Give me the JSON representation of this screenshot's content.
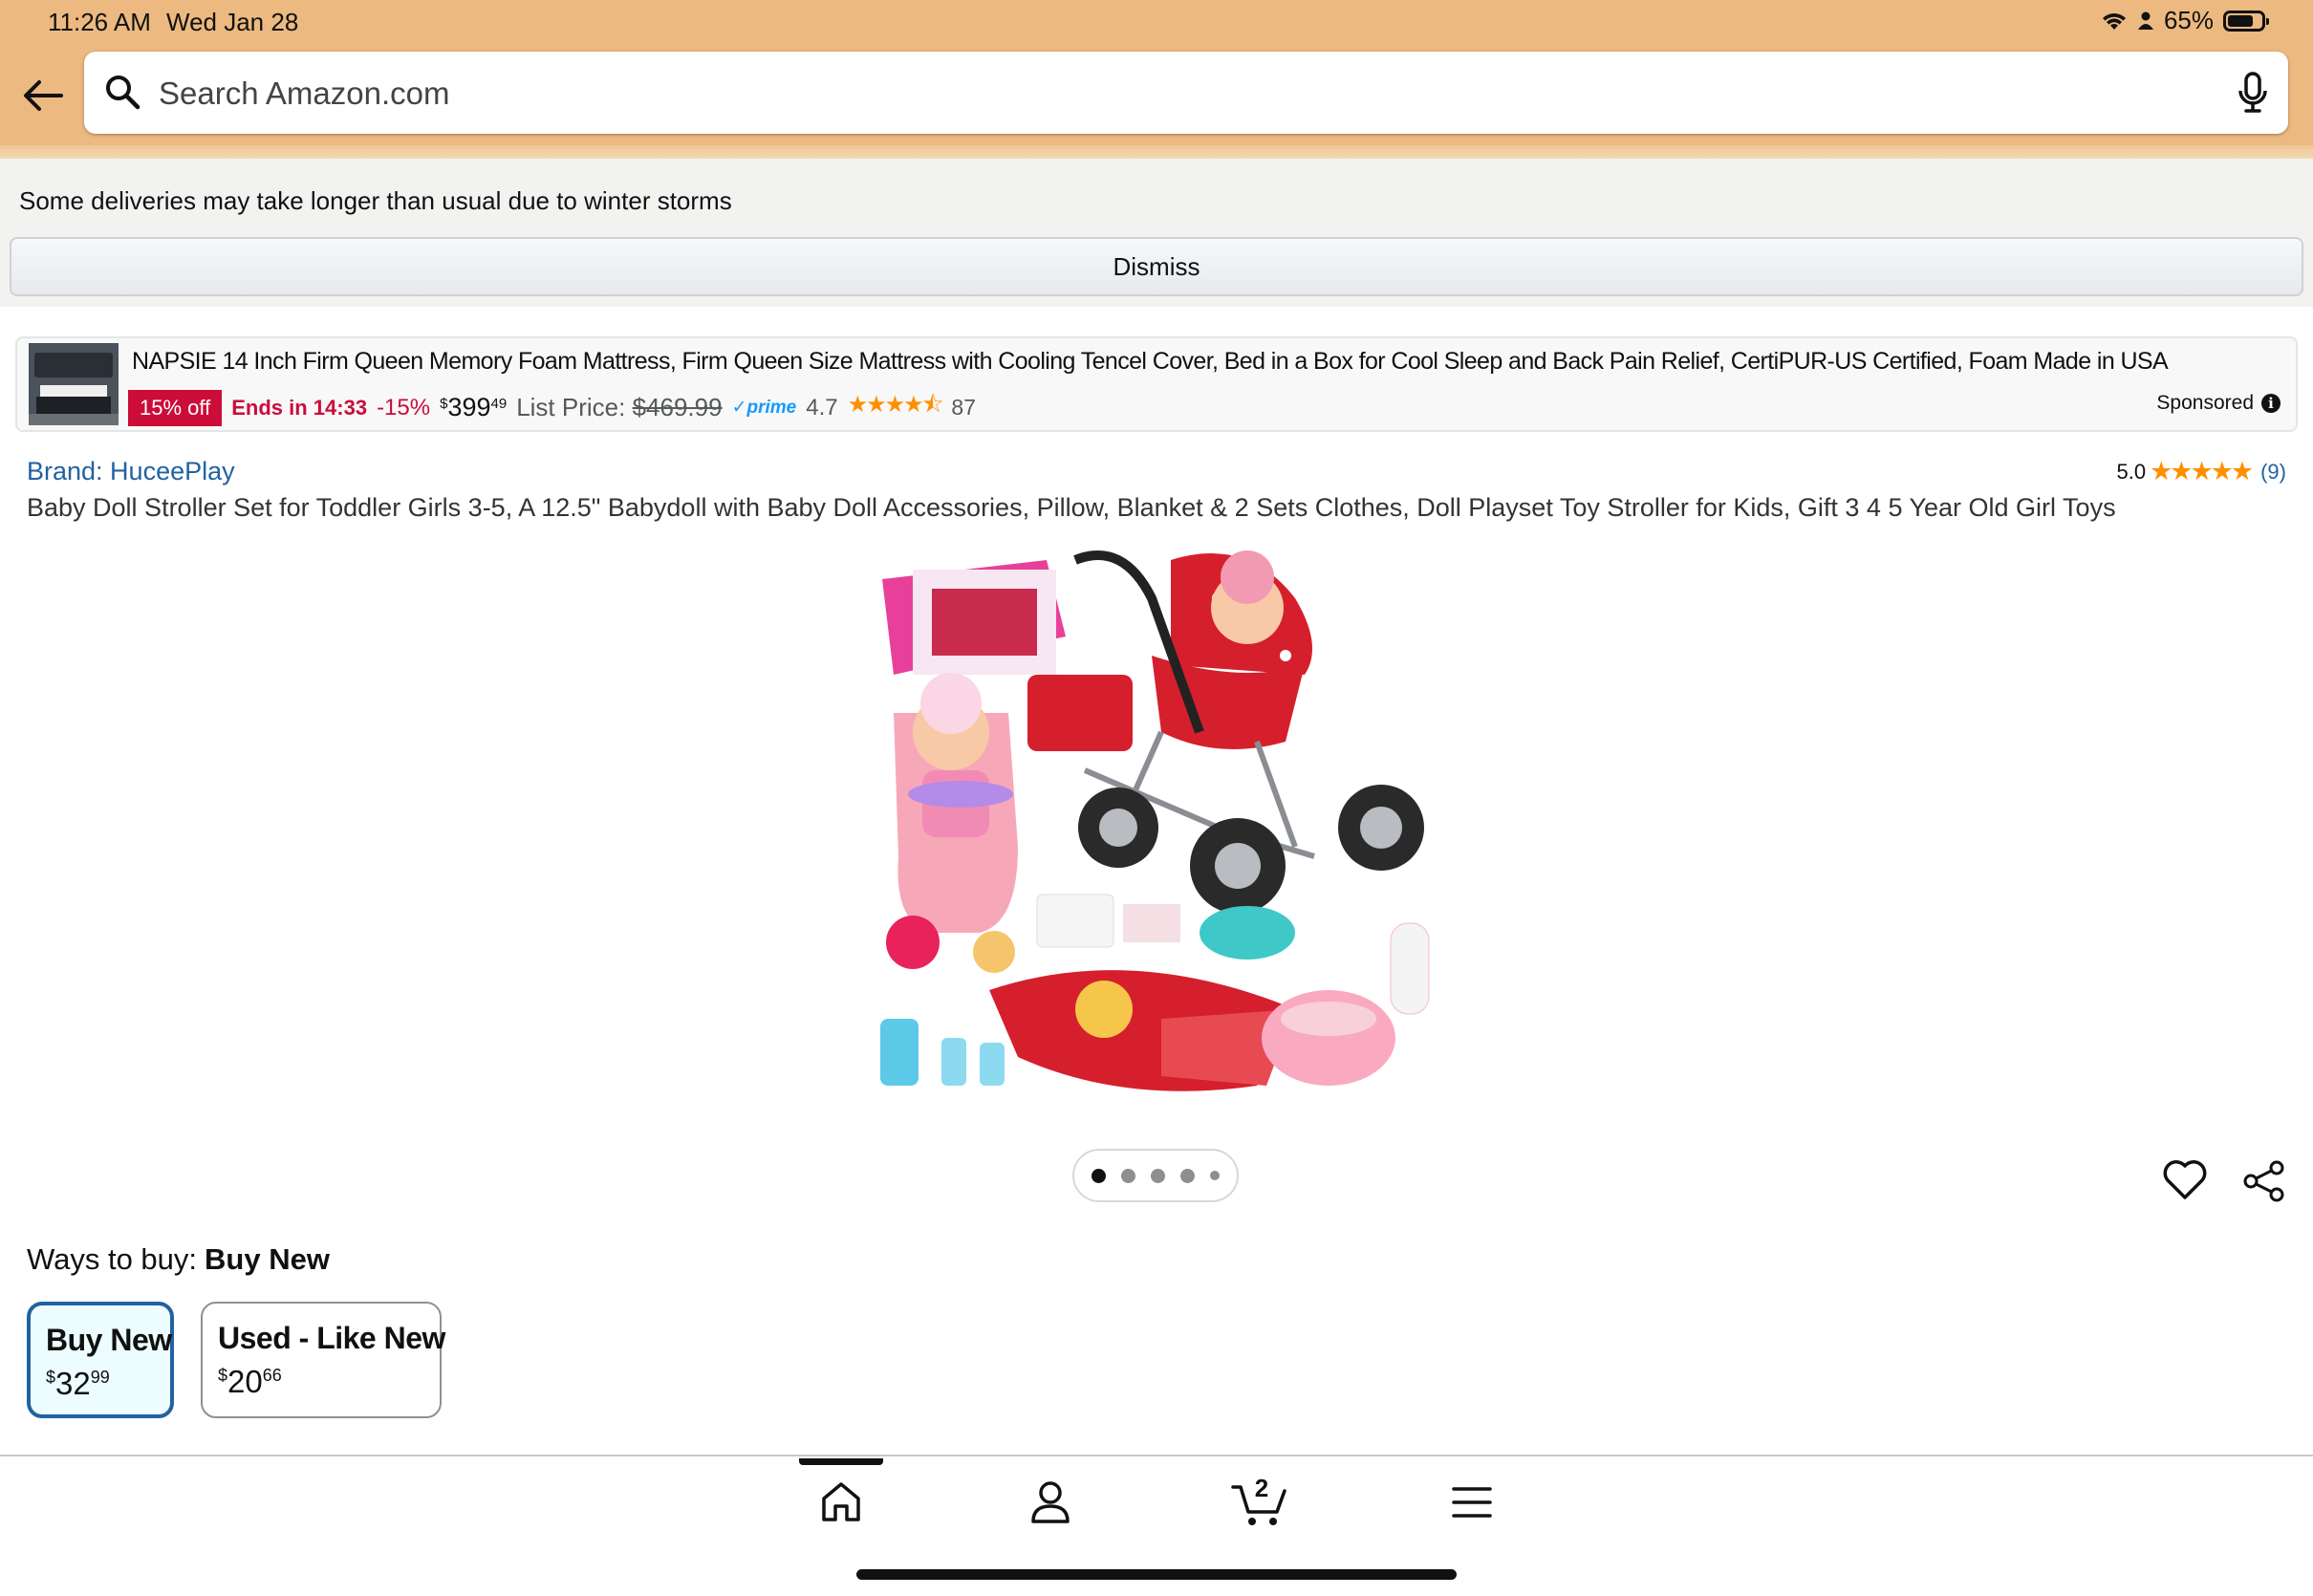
{
  "status_bar": {
    "time": "11:26 AM",
    "date": "Wed Jan 28",
    "battery": "65%"
  },
  "search": {
    "placeholder": "Search Amazon.com"
  },
  "alert": {
    "message": "Some deliveries may take longer than usual due to winter storms",
    "dismiss_label": "Dismiss"
  },
  "ad": {
    "title": "NAPSIE 14 Inch Firm Queen Memory Foam Mattress, Firm Queen Size Mattress with Cooling Tencel Cover, Bed in a Box for Cool Sleep and Back Pain Relief, CertiPUR-US Certified, Foam Made in USA",
    "deal_badge": "15% off",
    "deal_timer": "Ends in 14:33",
    "discount": "-15%",
    "price_symbol": "$",
    "price_whole": "399",
    "price_fraction": "49",
    "list_price_label": "List Price:",
    "list_price": "$469.99",
    "prime_label": "prime",
    "rating": "4.7",
    "stars": "★★★★⯪",
    "review_count": "87",
    "sponsored_label": "Sponsored",
    "info_symbol": "i"
  },
  "product": {
    "brand": "Brand: HuceePlay",
    "rating": "5.0",
    "stars": "★★★★★",
    "review_count": "(9)",
    "title": "Baby Doll Stroller Set for Toddler Girls 3-5, A 12.5\" Babydoll with Baby Doll Accessories, Pillow, Blanket & 2 Sets Clothes, Doll Playset Toy Stroller for Kids, Gift 3 4 5 Year Old Girl Toys",
    "image_count": 5,
    "image_active_index": 0
  },
  "ways_to_buy": {
    "label": "Ways to buy:",
    "selected": "Buy New",
    "options": [
      {
        "title": "Buy New",
        "symbol": "$",
        "whole": "32",
        "fraction": "99"
      },
      {
        "title": "Used - Like New",
        "symbol": "$",
        "whole": "20",
        "fraction": "66"
      }
    ]
  },
  "bottom_nav": {
    "items": [
      {
        "icon": "home-icon",
        "active": true
      },
      {
        "icon": "account-icon",
        "active": false
      },
      {
        "icon": "cart-icon",
        "active": false,
        "badge": "2"
      },
      {
        "icon": "menu-icon",
        "active": false
      }
    ]
  }
}
